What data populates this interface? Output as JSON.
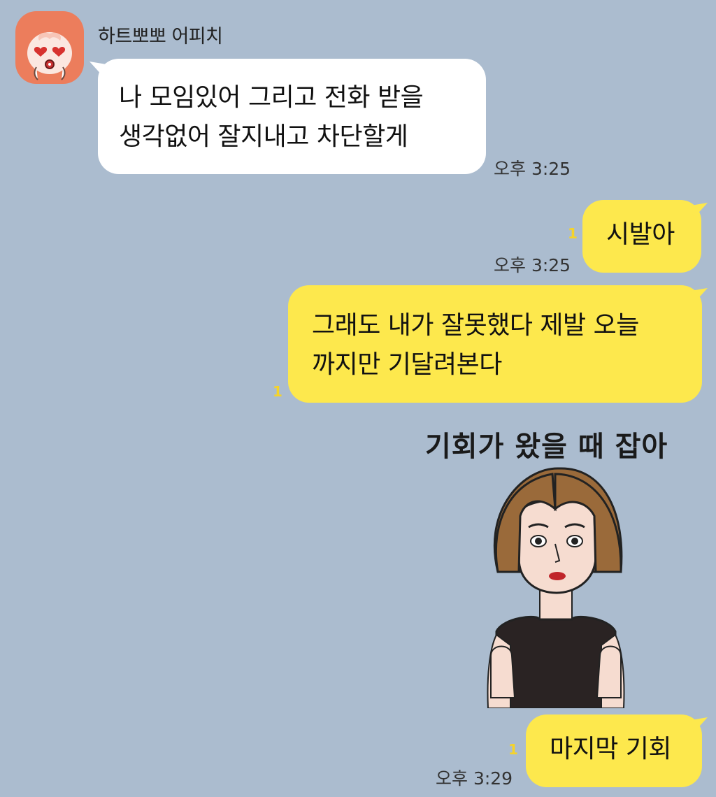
{
  "chat": {
    "sender_name": "하트뽀뽀 어피치",
    "messages": [
      {
        "direction": "incoming",
        "lines": [
          "나 모임있어 그리고 전화 받을",
          "생각없어 잘지내고 차단할게"
        ],
        "time": "오후 3:25"
      },
      {
        "direction": "outgoing",
        "lines": [
          "시발아"
        ],
        "time": "오후 3:25",
        "unread": "1"
      },
      {
        "direction": "outgoing",
        "lines": [
          "그래도 내가 잘못했다 제발 오늘",
          "까지만 기달려본다"
        ],
        "unread": "1"
      },
      {
        "direction": "outgoing",
        "sticker_caption": "기회가 왔을 때 잡아"
      },
      {
        "direction": "outgoing",
        "lines": [
          "마지막 기회"
        ],
        "time": "오후 3:29",
        "unread": "1"
      }
    ]
  },
  "icons": {
    "avatar": "peach-character-icon",
    "sticker": "woman-sticker-icon"
  },
  "colors": {
    "background": "#abbccf",
    "incoming_bubble": "#ffffff",
    "outgoing_bubble": "#fde84d",
    "unread_count": "#f5d32a",
    "avatar_bg": "#ec7d5c"
  }
}
